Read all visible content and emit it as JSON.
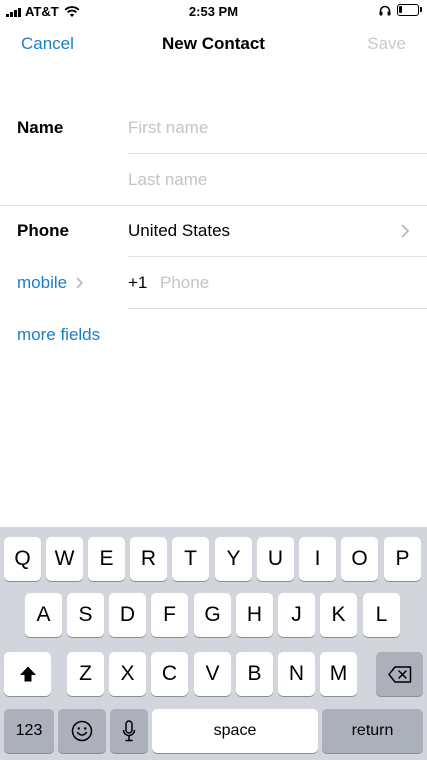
{
  "status_bar": {
    "carrier": "AT&T",
    "time": "2:53 PM",
    "battery_level": 0.15
  },
  "nav": {
    "cancel": "Cancel",
    "title": "New Contact",
    "save": "Save"
  },
  "form": {
    "name_label": "Name",
    "first_name_placeholder": "First name",
    "last_name_placeholder": "Last name",
    "phone_label": "Phone",
    "country": "United States",
    "phone_type": "mobile",
    "country_code": "+1",
    "phone_placeholder": "Phone",
    "more_fields": "more fields"
  },
  "keyboard": {
    "row1": [
      "Q",
      "W",
      "E",
      "R",
      "T",
      "Y",
      "U",
      "I",
      "O",
      "P"
    ],
    "row2": [
      "A",
      "S",
      "D",
      "F",
      "G",
      "H",
      "J",
      "K",
      "L"
    ],
    "row3": [
      "Z",
      "X",
      "C",
      "V",
      "B",
      "N",
      "M"
    ],
    "numbers_key": "123",
    "space_key": "space",
    "return_key": "return"
  },
  "icons": [
    "signal-icon",
    "wifi-icon",
    "headphones-icon",
    "battery-icon",
    "chevron-right-icon",
    "shift-icon",
    "backspace-icon",
    "emoji-icon",
    "microphone-icon"
  ],
  "colors": {
    "accent": "#1a7fc9",
    "disabled": "#c9c9ce",
    "placeholder": "#c4c4c9",
    "keyboard_bg": "#d2d5db",
    "key_dark": "#abb0ba"
  }
}
